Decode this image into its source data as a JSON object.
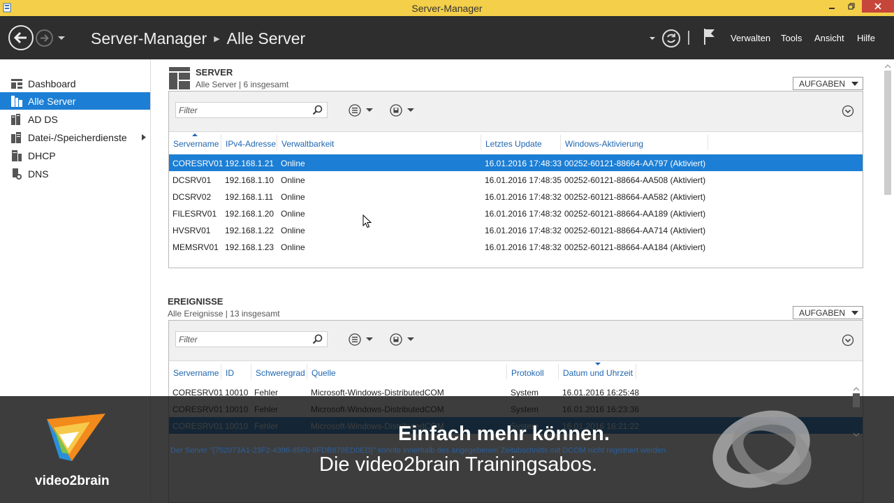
{
  "window": {
    "title": "Server-Manager"
  },
  "header": {
    "breadcrumb": [
      "Server-Manager",
      "Alle Server"
    ],
    "menu": [
      "Verwalten",
      "Tools",
      "Ansicht",
      "Hilfe"
    ]
  },
  "sidebar": {
    "items": [
      {
        "label": "Dashboard",
        "icon": "dashboard-icon"
      },
      {
        "label": "Alle Server",
        "icon": "servers-icon",
        "active": true
      },
      {
        "label": "AD DS",
        "icon": "ad-ds-icon"
      },
      {
        "label": "Datei-/Speicherdienste",
        "icon": "storage-icon",
        "has_children": true
      },
      {
        "label": "DHCP",
        "icon": "dhcp-icon"
      },
      {
        "label": "DNS",
        "icon": "dns-icon"
      }
    ]
  },
  "server_section": {
    "title": "SERVER",
    "subtitle": "Alle Server | 6 insgesamt",
    "tasks_label": "AUFGABEN",
    "filter_placeholder": "Filter",
    "columns": [
      "Servername",
      "IPv4-Adresse",
      "Verwaltbarkeit",
      "Letztes Update",
      "Windows-Aktivierung"
    ],
    "rows": [
      [
        "CORESRV01",
        "192.168.1.21",
        "Online",
        "16.01.2016 17:48:33",
        "00252-60121-88664-AA797 (Aktiviert)"
      ],
      [
        "DCSRV01",
        "192.168.1.10",
        "Online",
        "16.01.2016 17:48:35",
        "00252-60121-88664-AA508 (Aktiviert)"
      ],
      [
        "DCSRV02",
        "192.168.1.11",
        "Online",
        "16.01.2016 17:48:32",
        "00252-60121-88664-AA582 (Aktiviert)"
      ],
      [
        "FILESRV01",
        "192.168.1.20",
        "Online",
        "16.01.2016 17:48:32",
        "00252-60121-88664-AA189 (Aktiviert)"
      ],
      [
        "HVSRV01",
        "192.168.1.22",
        "Online",
        "16.01.2016 17:48:32",
        "00252-60121-88664-AA714 (Aktiviert)"
      ],
      [
        "MEMSRV01",
        "192.168.1.23",
        "Online",
        "16.01.2016 17:48:32",
        "00252-60121-88664-AA184 (Aktiviert)"
      ]
    ],
    "selected_row": 0
  },
  "events_section": {
    "title": "EREIGNISSE",
    "subtitle": "Alle Ereignisse | 13 insgesamt",
    "tasks_label": "AUFGABEN",
    "filter_placeholder": "Filter",
    "columns": [
      "Servername",
      "ID",
      "Schweregrad",
      "Quelle",
      "Protokoll",
      "Datum und Uhrzeit"
    ],
    "rows": [
      [
        "CORESRV01",
        "10010",
        "Fehler",
        "Microsoft-Windows-DistributedCOM",
        "System",
        "16.01.2016 16:25:48"
      ],
      [
        "CORESRV01",
        "10010",
        "Fehler",
        "Microsoft-Windows-DistributedCOM",
        "System",
        "16.01.2016 16:23:36"
      ],
      [
        "CORESRV01",
        "10010",
        "Fehler",
        "Microsoft-Windows-DistributedCOM",
        "System",
        "16.01.2016 16:21:22"
      ]
    ],
    "selected_row": 2,
    "status_text": "Der Server \"{752073A1-23F2-4396-85F0-8FDB879ED0ED}\" konnte innerhalb des angegebenen Zeitabschnitts mit DCOM nicht registriert werden."
  },
  "overlay": {
    "brand": "video2brain",
    "tagline_1": "Einfach mehr können.",
    "tagline_2": "Die video2brain Trainingsabos."
  },
  "colors": {
    "titlebar": "#f4cf49",
    "header": "#2e2e2e",
    "selection": "#1c7ed4",
    "link": "#1f66b0",
    "close": "#c7463b"
  }
}
